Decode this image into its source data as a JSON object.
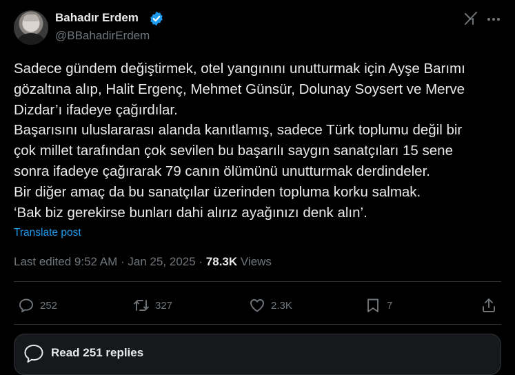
{
  "author": {
    "display_name": "Bahadır Erdem",
    "handle": "@BBahadirErdem",
    "verified": true
  },
  "post": {
    "lines": [
      "Sadece gündem değiştirmek, otel yangınını unutturmak için Ayşe Barımı",
      "gözaltına alıp, Halit Ergenç, Mehmet Günsür, Dolunay Soysert ve Merve",
      "Dizdar’ı ifadeye çağırdılar.",
      "Başarısını uluslararası alanda kanıtlamış, sadece Türk toplumu değil bir",
      "çok millet tarafından çok sevilen bu başarılı saygın sanatçıları 15 sene",
      "sonra ifadeye çağırarak 79 canın ölümünü unutturmak derdindeler.",
      "Bir diğer amaç da bu sanatçılar üzerinden topluma korku salmak.",
      "‘Bak biz gerekirse bunları dahi alırız ayağınızı denk alın’."
    ],
    "translate_label": "Translate post"
  },
  "meta": {
    "edited_text": "Last edited 9:52 AM · Jan 25, 2025 · ",
    "views_count": "78.3K",
    "views_label": " Views"
  },
  "actions": {
    "replies": "252",
    "reposts": "327",
    "likes": "2.3K",
    "bookmarks": "7"
  },
  "read_replies_label": "Read 251 replies",
  "colors": {
    "background": "#000000",
    "text": "#e7e9ea",
    "secondary": "#71767b",
    "accent": "#1d9bf0"
  }
}
